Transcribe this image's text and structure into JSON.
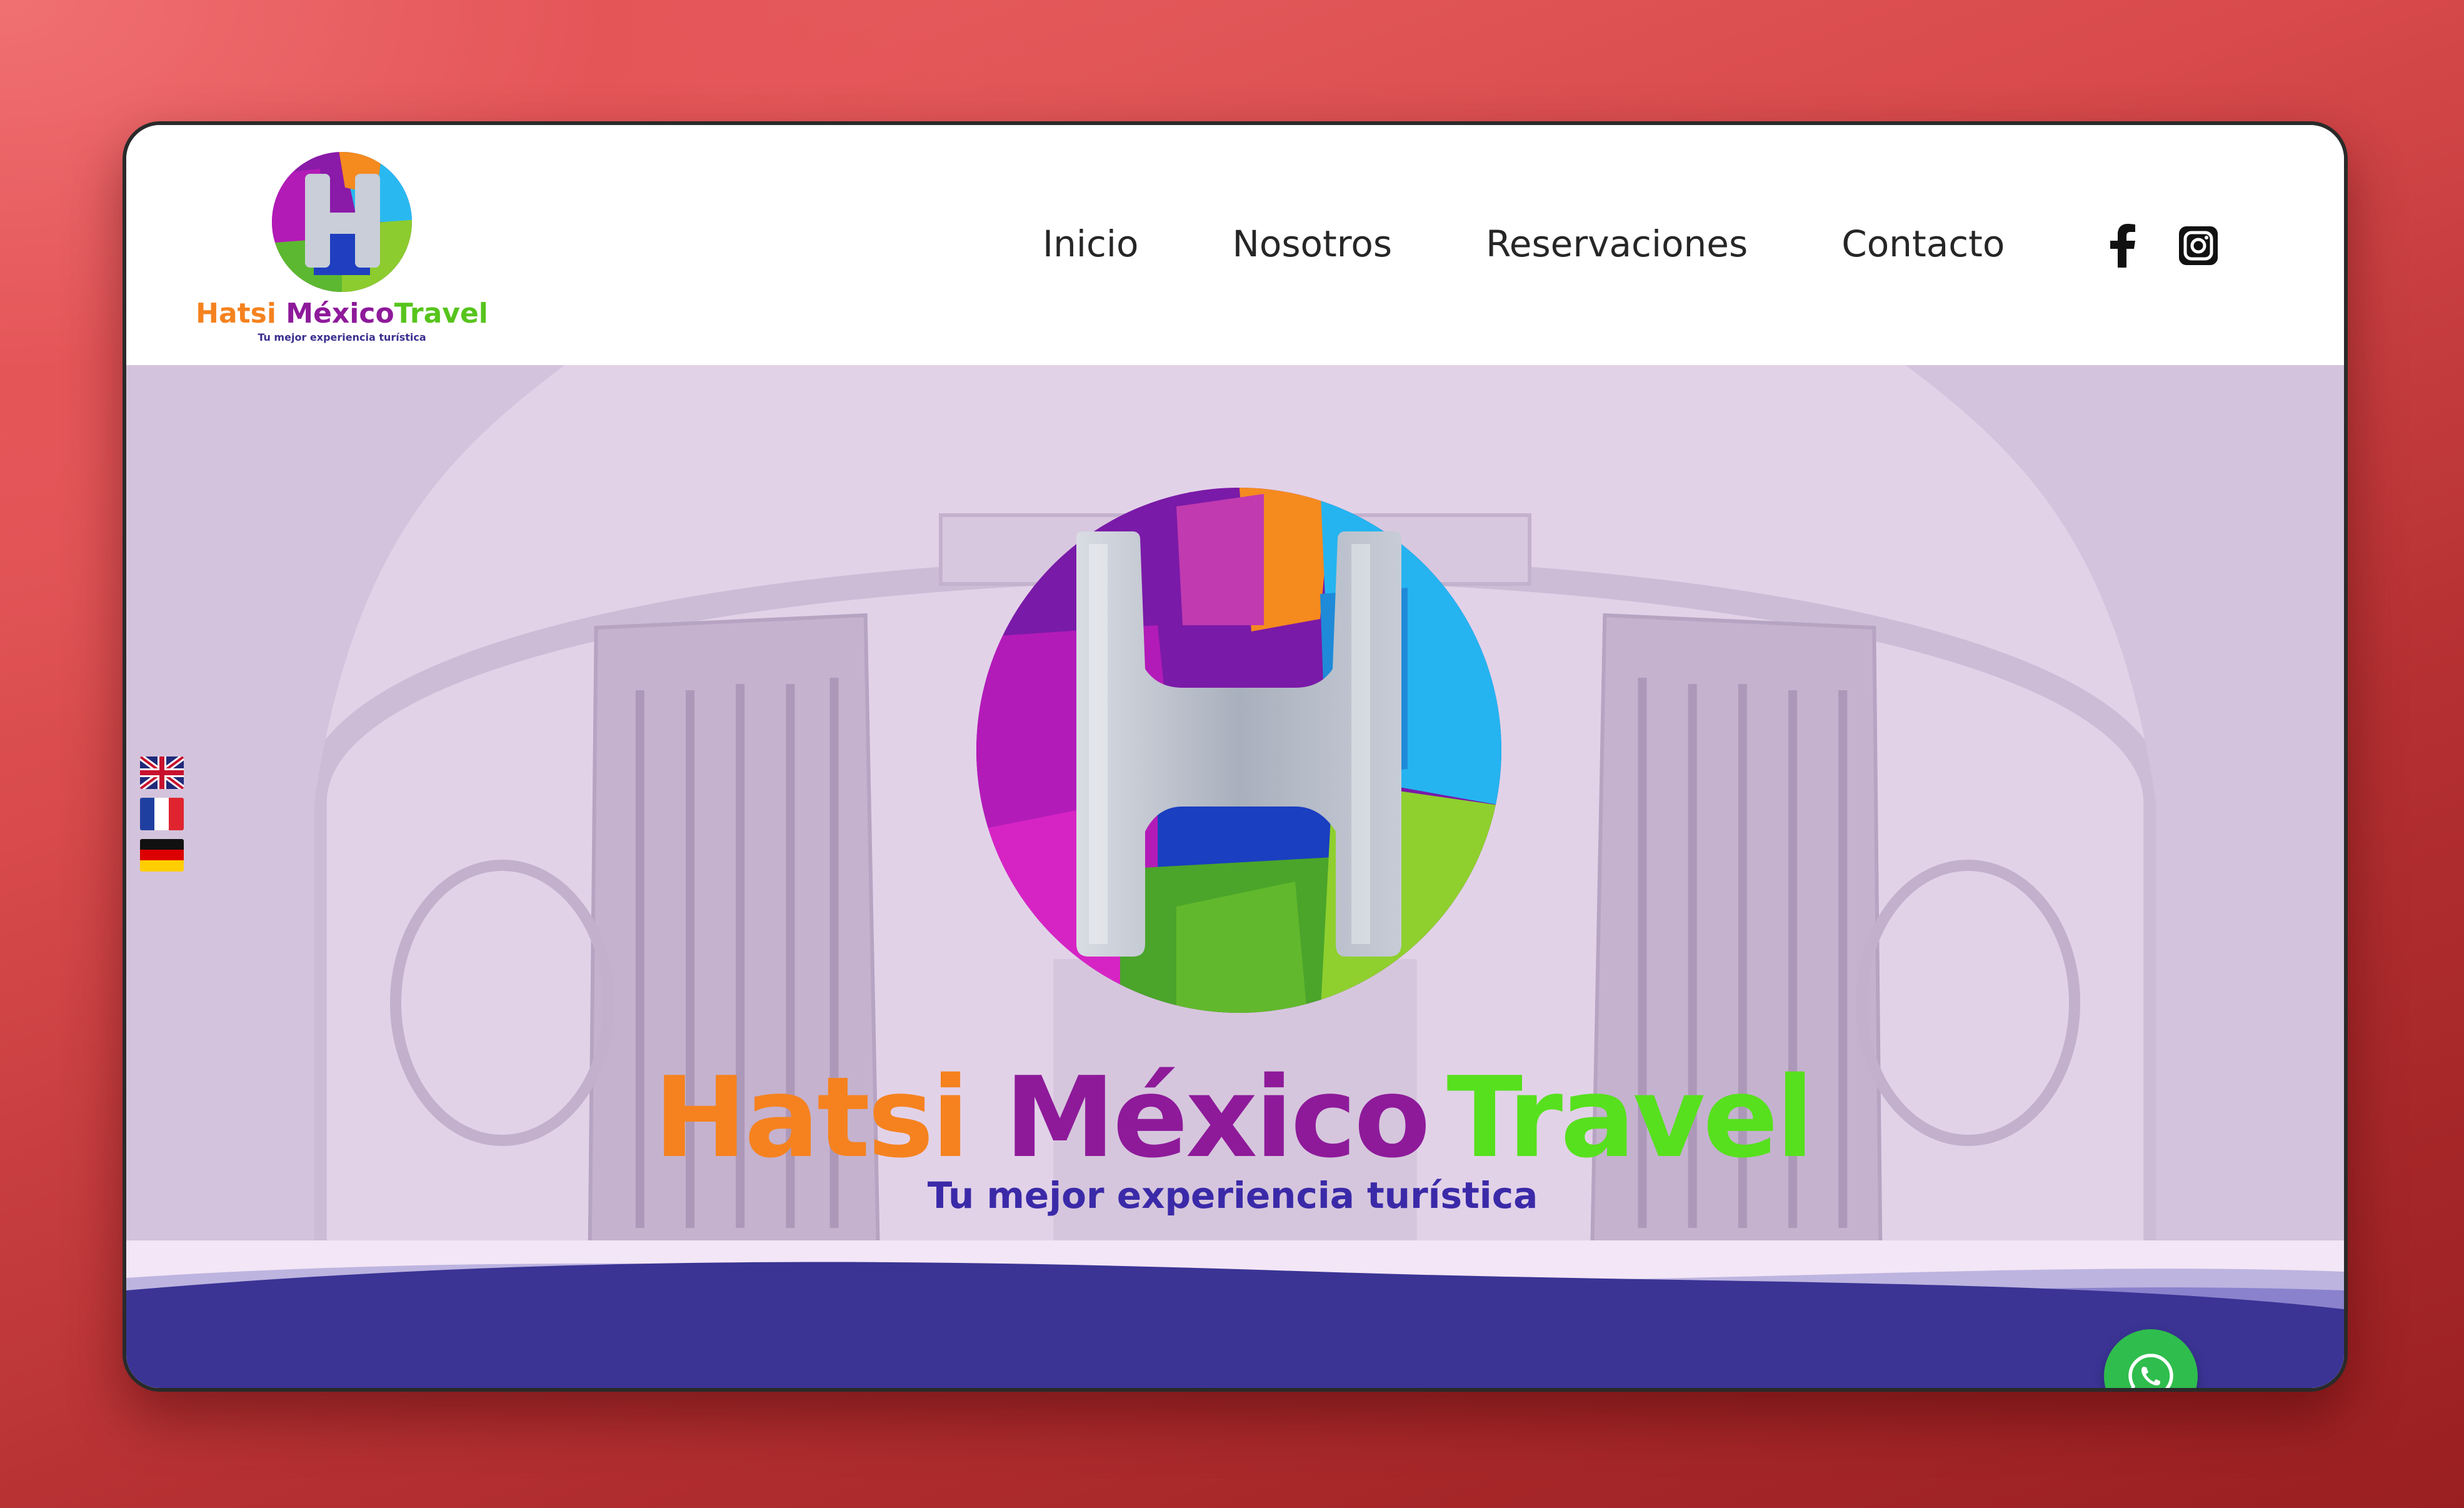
{
  "header": {
    "logo": {
      "word1": "Hatsi",
      "word2": "México",
      "word3": "Travel",
      "tagline": "Tu mejor experiencia turística"
    },
    "nav": [
      {
        "label": "Inicio"
      },
      {
        "label": "Nosotros"
      },
      {
        "label": "Reservaciones"
      },
      {
        "label": "Contacto"
      }
    ],
    "social": [
      "facebook-icon",
      "instagram-icon"
    ]
  },
  "hero": {
    "brand": {
      "word1": "Hatsi",
      "word2": "México",
      "word3": "Travel",
      "colors": {
        "word1": "#f5821f",
        "word2": "#8e1a9a",
        "word3": "#57e01d"
      }
    },
    "tagline": "Tu mejor experiencia turística",
    "languages": [
      "english-flag",
      "french-flag",
      "german-flag"
    ]
  },
  "floating": {
    "whatsapp": "whatsapp-icon"
  },
  "colors": {
    "accent": "#3b3495",
    "whatsapp": "#2fbd4d"
  }
}
